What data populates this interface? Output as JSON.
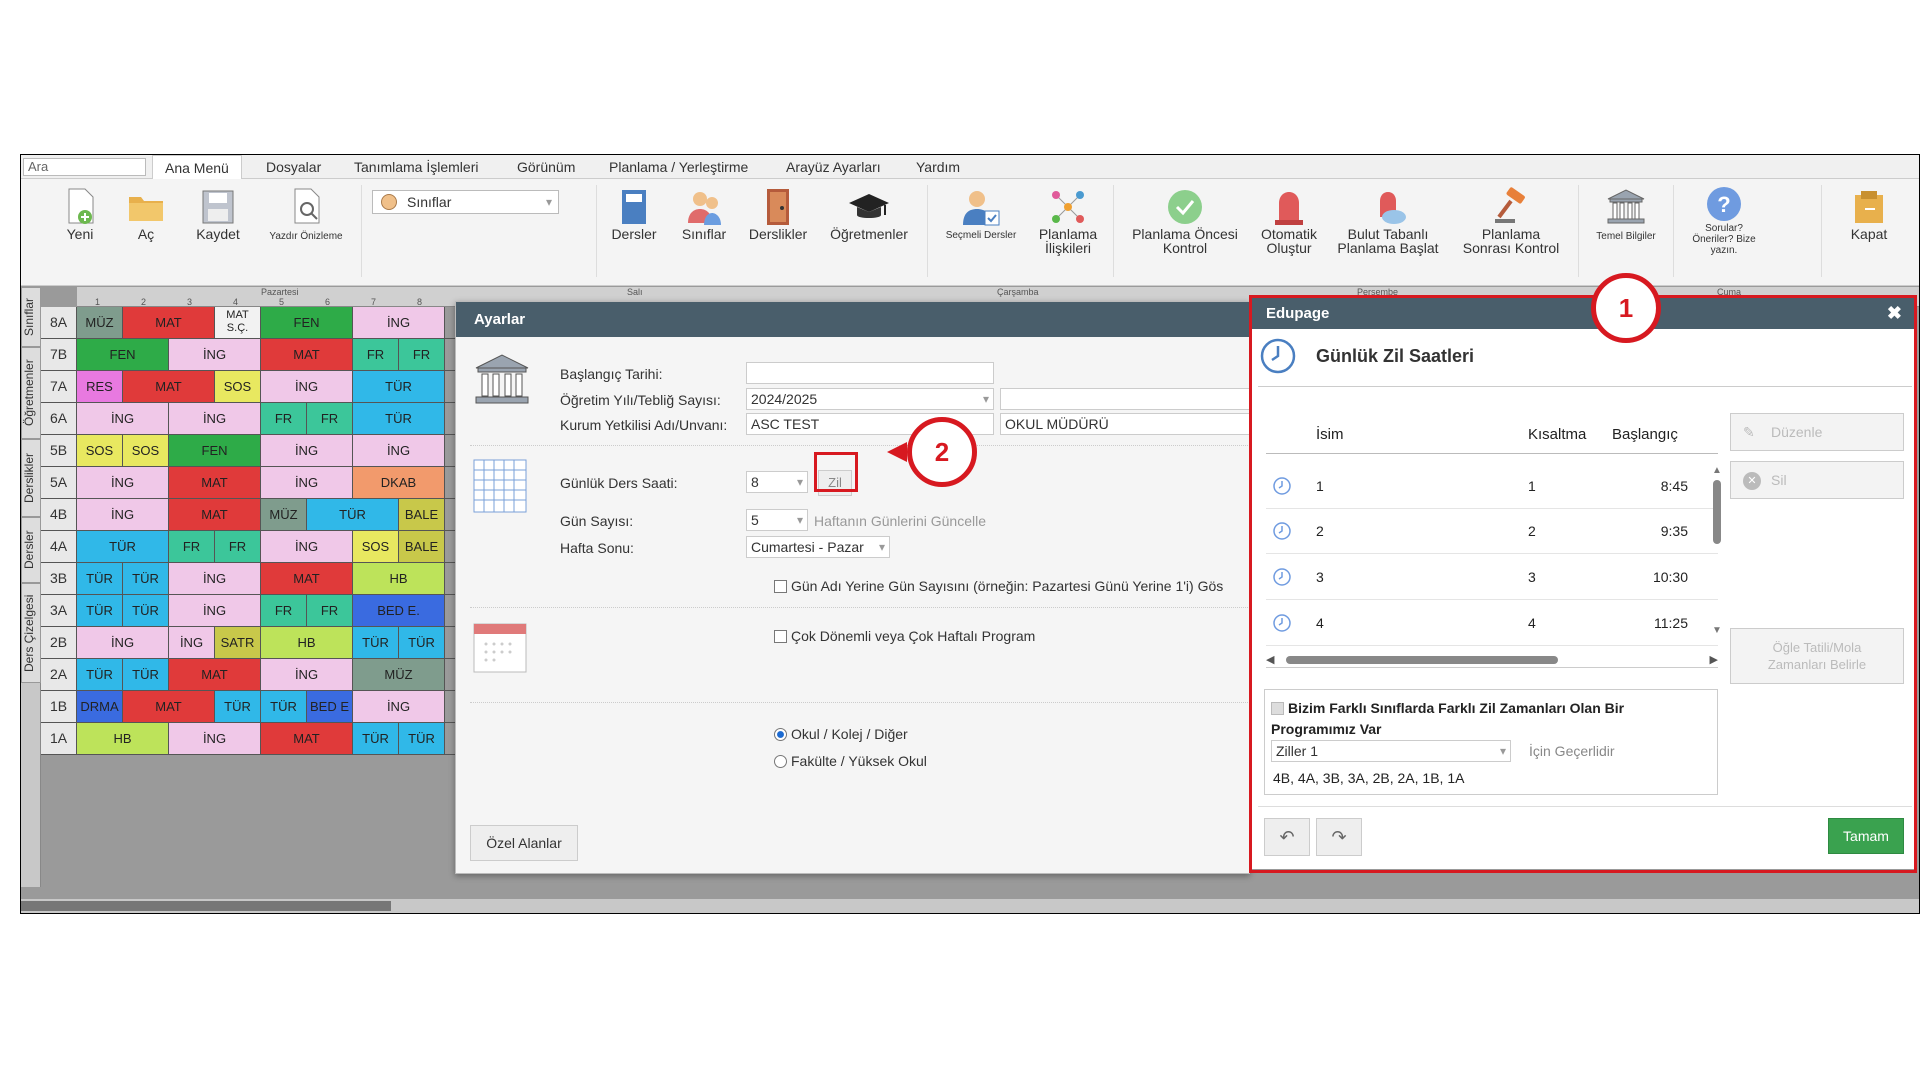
{
  "search": {
    "value": "Ara"
  },
  "menu": [
    "Ana Menü",
    "Dosyalar",
    "Tanımlama İşlemleri",
    "Görünüm",
    "Planlama / Yerleştirme",
    "Arayüz Ayarları",
    "Yardım"
  ],
  "ribbon": {
    "new": "Yeni",
    "open": "Aç",
    "save": "Kaydet",
    "print_preview": "Yazdır Önizleme",
    "view_select": "Sınıflar",
    "subjects": "Dersler",
    "classes": "Sınıflar",
    "classrooms": "Derslikler",
    "teachers": "Öğretmenler",
    "electives": "Seçmeli Dersler",
    "relations_1": "Planlama",
    "relations_2": "İlişkileri",
    "precheck_1": "Planlama Öncesi",
    "precheck_2": "Kontrol",
    "auto_1": "Otomatik",
    "auto_2": "Oluştur",
    "cloud_1": "Bulut Tabanlı",
    "cloud_2": "Planlama Başlat",
    "postcheck_1": "Planlama",
    "postcheck_2": "Sonrası Kontrol",
    "basic_info": "Temel Bilgiler",
    "questions_1": "Sorular?",
    "questions_2": "Öneriler? Bize",
    "questions_3": "yazın.",
    "close": "Kapat"
  },
  "days": [
    "Pazartesi",
    "Salı",
    "Çarşamba",
    "Perşembe",
    "Cuma"
  ],
  "periods": [
    "1",
    "2",
    "3",
    "4",
    "5",
    "6",
    "7",
    "8"
  ],
  "side_tabs": [
    "Sınıflar",
    "Öğretmenler",
    "Derslikler",
    "Dersler",
    "Ders Çizelgesi"
  ],
  "grid": {
    "rows": [
      {
        "name": "8A",
        "cells": [
          [
            "MÜZ",
            "#7f9c8d",
            1
          ],
          [
            "MAT",
            "#e03a3a",
            2
          ],
          [
            "MAT S.Ç.",
            "#f2f2f2",
            1
          ],
          [
            "FEN",
            "#2eab48",
            2
          ],
          [
            "İNG",
            "#f0c8e8",
            2
          ]
        ]
      },
      {
        "name": "7B",
        "cells": [
          [
            "FEN",
            "#2eab48",
            2
          ],
          [
            "İNG",
            "#f0c8e8",
            2
          ],
          [
            "MAT",
            "#e03a3a",
            2
          ],
          [
            "FR",
            "#3cc69a",
            1
          ],
          [
            "FR",
            "#3cc69a",
            1
          ]
        ]
      },
      {
        "name": "7A",
        "cells": [
          [
            "RES",
            "#e879e0",
            1
          ],
          [
            "MAT",
            "#e03a3a",
            2
          ],
          [
            "SOS",
            "#e8e860",
            1
          ],
          [
            "İNG",
            "#f0c8e8",
            2
          ],
          [
            "TÜR",
            "#30b8e8",
            2
          ]
        ]
      },
      {
        "name": "6A",
        "cells": [
          [
            "İNG",
            "#f0c8e8",
            2
          ],
          [
            "İNG",
            "#f0c8e8",
            2
          ],
          [
            "FR",
            "#3cc69a",
            1
          ],
          [
            "FR",
            "#3cc69a",
            1
          ],
          [
            "TÜR",
            "#30b8e8",
            2
          ]
        ]
      },
      {
        "name": "5B",
        "cells": [
          [
            "SOS",
            "#e8e860",
            1
          ],
          [
            "SOS",
            "#e8e860",
            1
          ],
          [
            "FEN",
            "#2eab48",
            2
          ],
          [
            "İNG",
            "#f0c8e8",
            2
          ],
          [
            "İNG",
            "#f0c8e8",
            2
          ]
        ]
      },
      {
        "name": "5A",
        "cells": [
          [
            "İNG",
            "#f0c8e8",
            2
          ],
          [
            "MAT",
            "#e03a3a",
            2
          ],
          [
            "İNG",
            "#f0c8e8",
            2
          ],
          [
            "DKAB",
            "#f29a6c",
            2
          ]
        ]
      },
      {
        "name": "4B",
        "cells": [
          [
            "İNG",
            "#f0c8e8",
            2
          ],
          [
            "MAT",
            "#e03a3a",
            2
          ],
          [
            "MÜZ",
            "#7f9c8d",
            1
          ],
          [
            "TÜR",
            "#30b8e8",
            2
          ],
          [
            "BALE",
            "#c8c84a",
            1
          ]
        ]
      },
      {
        "name": "4A",
        "cells": [
          [
            "TÜR",
            "#30b8e8",
            2
          ],
          [
            "FR",
            "#3cc69a",
            1
          ],
          [
            "FR",
            "#3cc69a",
            1
          ],
          [
            "İNG",
            "#f0c8e8",
            2
          ],
          [
            "SOS",
            "#e8e860",
            1
          ],
          [
            "BALE",
            "#c8c84a",
            1
          ]
        ]
      },
      {
        "name": "3B",
        "cells": [
          [
            "TÜR",
            "#30b8e8",
            1
          ],
          [
            "TÜR",
            "#30b8e8",
            1
          ],
          [
            "İNG",
            "#f0c8e8",
            2
          ],
          [
            "MAT",
            "#e03a3a",
            2
          ],
          [
            "HB",
            "#bde35a",
            2
          ]
        ]
      },
      {
        "name": "3A",
        "cells": [
          [
            "TÜR",
            "#30b8e8",
            1
          ],
          [
            "TÜR",
            "#30b8e8",
            1
          ],
          [
            "İNG",
            "#f0c8e8",
            2
          ],
          [
            "FR",
            "#3cc69a",
            1
          ],
          [
            "FR",
            "#3cc69a",
            1
          ],
          [
            "BED E.",
            "#3a6be0",
            2
          ]
        ]
      },
      {
        "name": "2B",
        "cells": [
          [
            "İNG",
            "#f0c8e8",
            2
          ],
          [
            "İNG",
            "#f0c8e8",
            1
          ],
          [
            "SATR",
            "#c8c84a",
            1
          ],
          [
            "HB",
            "#bde35a",
            2
          ],
          [
            "TÜR",
            "#30b8e8",
            1
          ],
          [
            "TÜR",
            "#30b8e8",
            1
          ]
        ]
      },
      {
        "name": "2A",
        "cells": [
          [
            "TÜR",
            "#30b8e8",
            1
          ],
          [
            "TÜR",
            "#30b8e8",
            1
          ],
          [
            "MAT",
            "#e03a3a",
            2
          ],
          [
            "İNG",
            "#f0c8e8",
            2
          ],
          [
            "MÜZ",
            "#7f9c8d",
            2
          ]
        ]
      },
      {
        "name": "1B",
        "cells": [
          [
            "DRMA",
            "#3a6be0",
            1
          ],
          [
            "MAT",
            "#e03a3a",
            2
          ],
          [
            "TÜR",
            "#30b8e8",
            1
          ],
          [
            "TÜR",
            "#30b8e8",
            1
          ],
          [
            "BED E",
            "#3a6be0",
            1
          ],
          [
            "İNG",
            "#f0c8e8",
            2
          ]
        ]
      },
      {
        "name": "1A",
        "cells": [
          [
            "HB",
            "#bde35a",
            2
          ],
          [
            "İNG",
            "#f0c8e8",
            2
          ],
          [
            "MAT",
            "#e03a3a",
            2
          ],
          [
            "TÜR",
            "#30b8e8",
            1
          ],
          [
            "TÜR",
            "#30b8e8",
            1
          ]
        ]
      }
    ]
  },
  "ayarlar": {
    "title": "Ayarlar",
    "start_date_label": "Başlangıç Tarihi:",
    "start_date_value": "",
    "year_label": "Öğretim Yılı/Tebliğ Sayısı:",
    "year_value": "2024/2025",
    "year_extra": "",
    "official_label": "Kurum Yetkilisi Adı/Unvanı:",
    "official_name": "ASC TEST",
    "official_title": "OKUL MÜDÜRÜ",
    "daily_label": "Günlük Ders Saati:",
    "daily_value": "8",
    "zil_button": "Zil",
    "days_label": "Gün Sayısı:",
    "days_value": "5",
    "update_days": "Haftanın Günlerini Güncelle",
    "weekend_label": "Hafta Sonu:",
    "weekend_value": "Cumartesi - Pazar",
    "day_number_check": "Gün Adı Yerine Gün Sayısını (örneğin: Pazartesi Günü Yerine 1'i) Gös",
    "multi_term_check": "Çok Dönemli veya Çok Haftalı Program",
    "radio_school": "Okul / Kolej / Diğer",
    "radio_faculty": "Fakülte / Yüksek Okul",
    "custom_fields": "Özel Alanlar"
  },
  "edupage": {
    "title": "Edupage",
    "heading": "Günlük Zil Saatleri",
    "col_name": "İsim",
    "col_abbr": "Kısaltma",
    "col_start": "Başlangıç",
    "rows": [
      {
        "name": "1",
        "abbr": "1",
        "start": "8:45"
      },
      {
        "name": "2",
        "abbr": "2",
        "start": "9:35"
      },
      {
        "name": "3",
        "abbr": "3",
        "start": "10:30"
      },
      {
        "name": "4",
        "abbr": "4",
        "start": "11:25"
      }
    ],
    "edit": "Düzenle",
    "delete": "Sil",
    "lunch_1": "Öğle Tatili/Mola",
    "lunch_2": "Zamanları Belirle",
    "diff_check": "Bizim Farklı Sınıflarda Farklı Zil Zamanları Olan Bir Programımız Var",
    "bell_select": "Ziller 1",
    "valid_for": "İçin Geçerlidir",
    "class_list": "4B, 4A, 3B, 3A, 2B, 2A, 1B, 1A",
    "ok": "Tamam"
  },
  "callouts": {
    "one": "1",
    "two": "2"
  },
  "colors": {
    "header": "#495e6b",
    "accent_red": "#d71920",
    "ok_green": "#3aa24f"
  }
}
